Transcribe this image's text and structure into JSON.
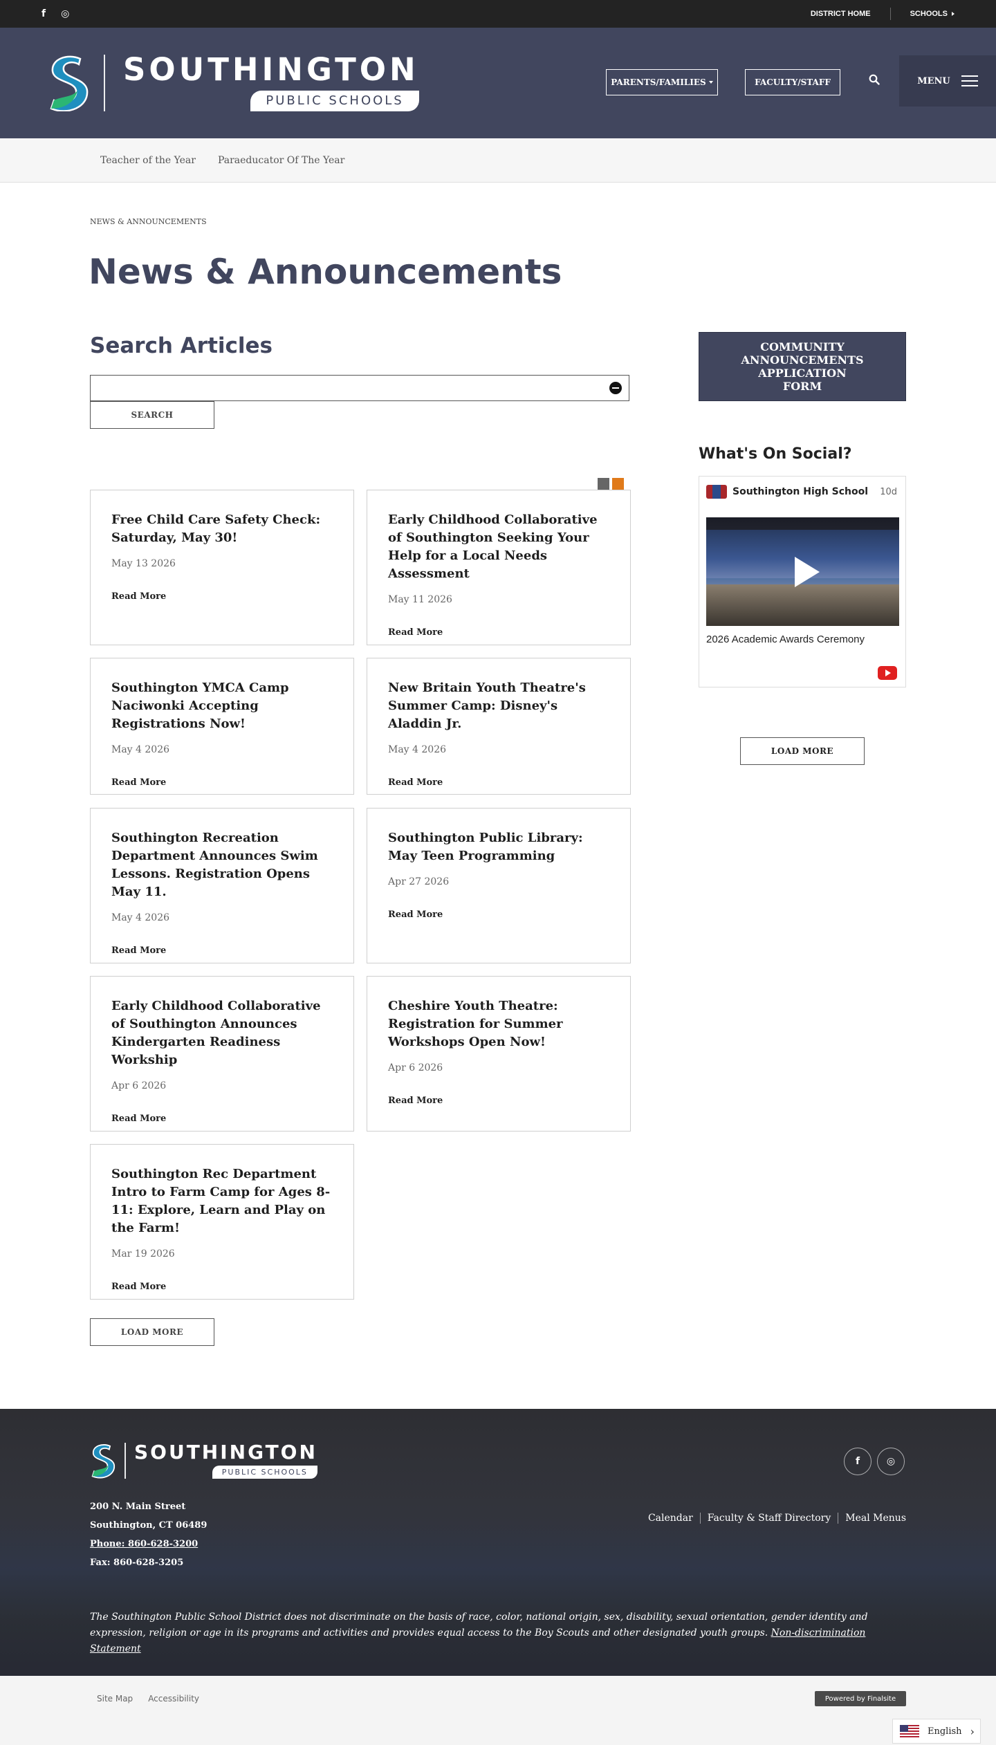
{
  "topbar": {
    "facebook_icon": "f",
    "instagram_icon": "◎",
    "district_home": "DISTRICT HOME",
    "schools": "SCHOOLS"
  },
  "header": {
    "logo_title": "SOUTHINGTON",
    "logo_subtitle": "PUBLIC SCHOOLS",
    "parents_families": "PARENTS/FAMILIES",
    "faculty_staff": "FACULTY/STAFF",
    "menu": "MENU"
  },
  "subnav": {
    "items": [
      "Teacher of the Year",
      "Paraeducator Of The Year"
    ]
  },
  "main": {
    "breadcrumb": "NEWS & ANNOUNCEMENTS",
    "title": "News & Announcements",
    "search_title": "Search Articles",
    "search_value": "",
    "search_button": "SEARCH",
    "load_more": "LOAD MORE",
    "read_more": "Read More",
    "articles": [
      {
        "title": "Free Child Care Safety Check: Saturday, May 30!",
        "date": "May 13 2026"
      },
      {
        "title": "Early Childhood Collaborative of Southington Seeking Your Help for a Local Needs Assessment",
        "date": "May 11 2026"
      },
      {
        "title": "Southington YMCA Camp Naciwonki Accepting Registrations Now!",
        "date": "May 4 2026"
      },
      {
        "title": "New Britain Youth Theatre's Summer Camp: Disney's Aladdin Jr.",
        "date": "May 4 2026"
      },
      {
        "title": "Southington Recreation Department Announces Swim Lessons. Registration Opens May 11.",
        "date": "May 4 2026"
      },
      {
        "title": "Southington Public Library: May Teen Programming",
        "date": "Apr 27 2026"
      },
      {
        "title": "Early Childhood Collaborative of Southington Announces Kindergarten Readiness Workship",
        "date": "Apr 6 2026"
      },
      {
        "title": "Cheshire Youth Theatre: Registration for Summer Workshops Open Now!",
        "date": "Apr 6 2026"
      },
      {
        "title": "Southington Rec Department Intro to Farm Camp for Ages 8-11: Explore, Learn and Play on the Farm!",
        "date": "Mar 19 2026"
      }
    ]
  },
  "sidebar": {
    "cta": "COMMUNITY ANNOUNCEMENTS APPLICATION FORM",
    "social_title": "What's On Social?",
    "post": {
      "account": "Southington High School",
      "age": "10d",
      "caption": "2026 Academic Awards Ceremony"
    },
    "load_more": "LOAD MORE"
  },
  "footer": {
    "logo_title": "SOUTHINGTON",
    "logo_subtitle": "PUBLIC SCHOOLS",
    "address_line1": "200 N. Main Street",
    "address_line2": "Southington, CT  06489",
    "phone": "Phone: 860-628-3200",
    "fax": "Fax: 860-628-3205",
    "links": [
      "Calendar",
      "Faculty & Staff Directory",
      "Meal Menus"
    ],
    "disclaimer": "The Southington Public School District does not discriminate on the basis of race, color, national origin, sex, disability, sexual orientation, gender identity and expression, religion or age in its programs and activities and provides equal access to the Boy Scouts and other designated youth groups.",
    "nondiscrimination": "Non-discrimination Statement"
  },
  "bottom": {
    "site_map": "Site Map",
    "accessibility": "Accessibility",
    "powered_by": "Powered by Finalsite",
    "language": "English",
    "language_arrow": "›"
  },
  "colors": {
    "brand_navy": "#41465e",
    "topbar": "#232323",
    "menu_box": "#373b50"
  }
}
